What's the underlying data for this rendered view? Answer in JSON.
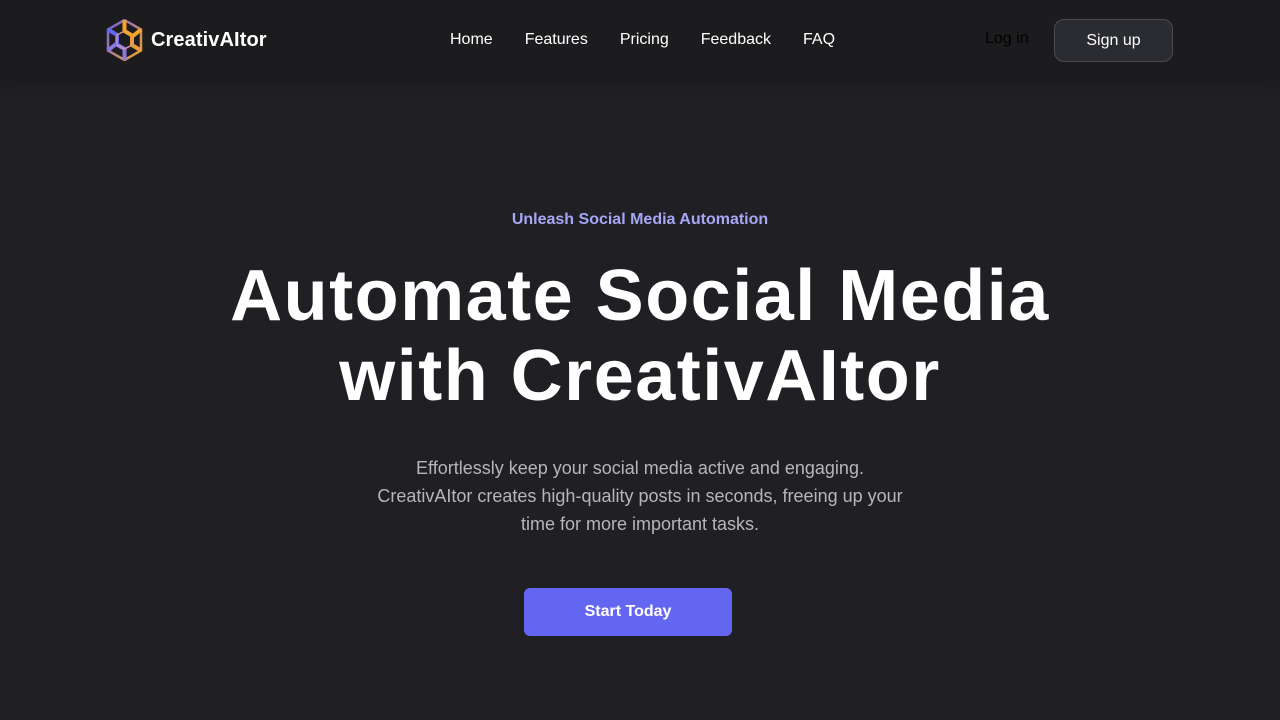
{
  "brand": {
    "name": "CreativAItor",
    "logo_icon": "hexagon-logo-icon",
    "logo_colors": [
      "#6366f1",
      "#f5a623"
    ]
  },
  "nav": {
    "items": [
      {
        "label": "Home"
      },
      {
        "label": "Features"
      },
      {
        "label": "Pricing"
      },
      {
        "label": "Feedback"
      },
      {
        "label": "FAQ"
      }
    ],
    "login_label": "Log in",
    "signup_label": "Sign up"
  },
  "hero": {
    "eyebrow": "Unleash Social Media Automation",
    "headline_line1": "Automate Social Media",
    "headline_line2": "with CreativAItor",
    "subtext": "Effortlessly keep your social media active and engaging. CreativAItor creates high-quality posts in seconds, freeing up your time for more important tasks.",
    "cta_label": "Start Today"
  },
  "colors": {
    "background": "#202024",
    "accent": "#6366f1",
    "eyebrow": "#a5a7f5"
  }
}
